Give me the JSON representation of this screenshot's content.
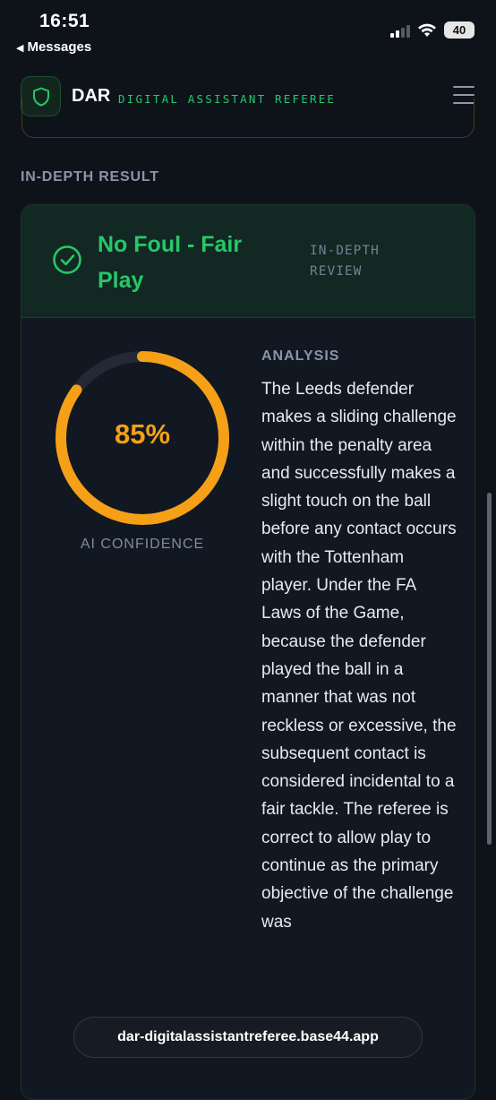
{
  "status_bar": {
    "time": "16:51",
    "back_label": "Messages",
    "battery": "40"
  },
  "header": {
    "brand": "DAR",
    "subtitle": "DIGITAL ASSISTANT REFEREE",
    "icons": [
      "shield-icon",
      "menu-icon"
    ],
    "accent_color": "#27c76a"
  },
  "section": {
    "label": "IN-DEPTH RESULT"
  },
  "result": {
    "verdict": "No Foul - Fair Play",
    "review_tag": "IN-DEPTH REVIEW",
    "verdict_color": "#27c76a",
    "icon": "check-circle-icon"
  },
  "confidence": {
    "value": 0.85,
    "display": "85%",
    "label": "AI CONFIDENCE",
    "color": "#f5a017"
  },
  "analysis": {
    "title": "ANALYSIS",
    "text": "The Leeds defender makes a sliding challenge within the penalty area and successfully makes a slight touch on the ball before any contact occurs with the Tottenham player. Under the FA Laws of the Game, because the defender played the ball in a manner that was not reckless or excessive, the subsequent contact is considered incidental to a fair tackle. The referee is correct to allow play to continue as the primary objective of the challenge was"
  },
  "browser": {
    "url": "dar-digitalassistantreferee.base44.app"
  }
}
